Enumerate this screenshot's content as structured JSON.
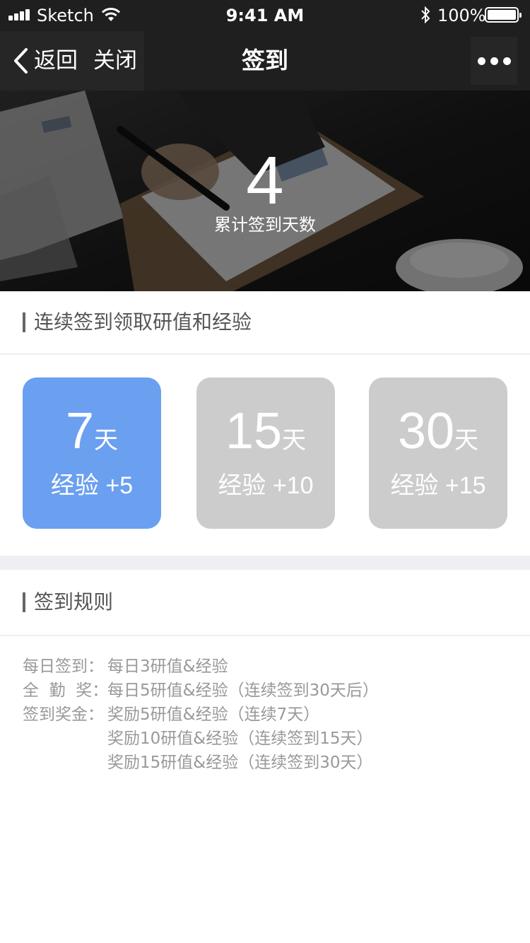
{
  "status_bar": {
    "carrier": "Sketch",
    "time": "9:41 AM",
    "battery": "100%"
  },
  "nav": {
    "back_label": "返回",
    "close_label": "关闭",
    "title": "签到"
  },
  "hero": {
    "count": "4",
    "label": "累计签到天数"
  },
  "streak_section": {
    "title": "连续签到领取研值和经验"
  },
  "cards": [
    {
      "days": "7",
      "unit": "天",
      "reward": "经验 +5",
      "active": true
    },
    {
      "days": "15",
      "unit": "天",
      "reward": "经验 +10",
      "active": false
    },
    {
      "days": "30",
      "unit": "天",
      "reward": "经验 +15",
      "active": false
    }
  ],
  "colors": {
    "active_card": "#6b9ff0",
    "inactive_card": "#cccccc",
    "bar_dark": "#1f1f1f"
  },
  "rules_section": {
    "title": "签到规则",
    "rows": [
      {
        "key": "每日签到：",
        "value": "每日3研值&经验"
      },
      {
        "key": "全  勤  奖：",
        "value": "每日5研值&经验（连续签到30天后）"
      },
      {
        "key": "签到奖金：",
        "value": "奖励5研值&经验（连续7天）"
      },
      {
        "key": "",
        "value": "奖励10研值&经验（连续签到15天）"
      },
      {
        "key": "",
        "value": "奖励15研值&经验（连续签到30天）"
      }
    ]
  }
}
